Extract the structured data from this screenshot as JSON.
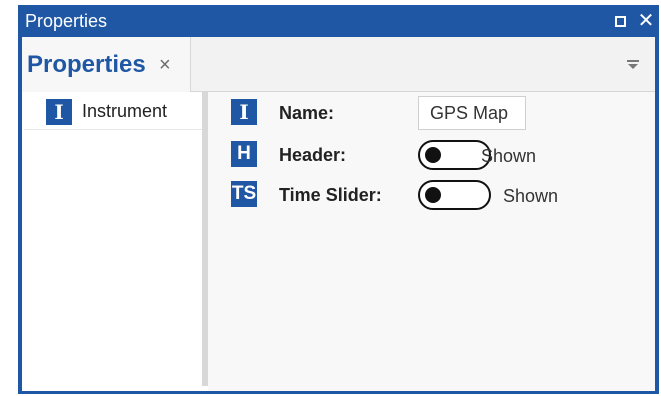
{
  "window": {
    "title": "Properties",
    "maximize_icon": "maximize-icon",
    "close_icon": "close-icon",
    "close_glyph": "✕"
  },
  "tab": {
    "label": "Properties",
    "close_glyph": "×",
    "menu_icon": "dropdown-menu-icon"
  },
  "tree": {
    "items": [
      {
        "badge": "I",
        "label": "Instrument"
      }
    ]
  },
  "properties": {
    "name": {
      "badge": "I",
      "label": "Name:",
      "value": "GPS Map"
    },
    "header": {
      "badge": "H",
      "label": "Header:",
      "state": "Shown",
      "on": false
    },
    "time_slider": {
      "badge": "TS",
      "label": "Time Slider:",
      "state": "Shown",
      "on": false
    }
  },
  "colors": {
    "accent": "#1f57a4",
    "panel_bg": "#f2f2f2",
    "toggle": "#111111"
  }
}
